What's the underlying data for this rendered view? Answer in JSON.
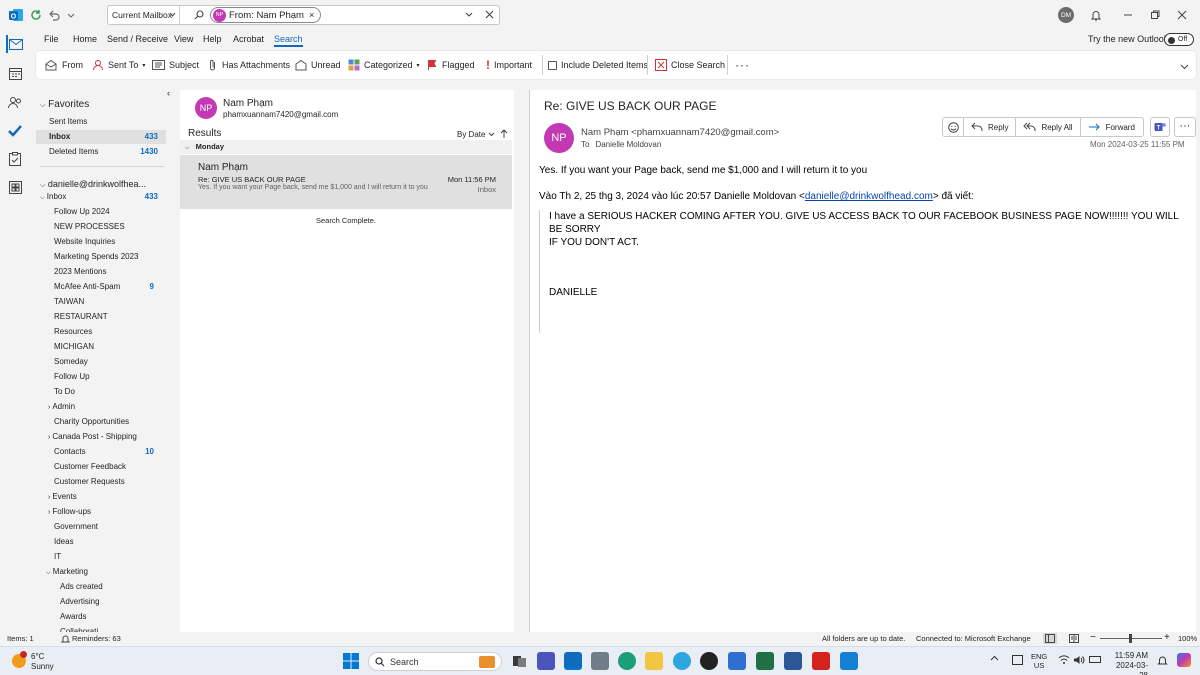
{
  "title_bar": {
    "scope": "Current Mailbox",
    "chip_initials": "NP",
    "chip_label": "From: Nam Phạm",
    "user_initials": "DM"
  },
  "menu": {
    "items": [
      "File",
      "Home",
      "Send / Receive",
      "View",
      "Help",
      "Acrobat",
      "Search"
    ],
    "active": "Search",
    "try_new": "Try the new Outlook",
    "toggle": "Off"
  },
  "ribbon": {
    "from": "From",
    "sent_to": "Sent To",
    "subject": "Subject",
    "has_attachments": "Has Attachments",
    "unread": "Unread",
    "categorized": "Categorized",
    "flagged": "Flagged",
    "important": "Important",
    "include_deleted": "Include Deleted Items",
    "close_search": "Close Search"
  },
  "folders": {
    "favorites_label": "Favorites",
    "favorites": [
      {
        "name": "Sent Items",
        "count": ""
      },
      {
        "name": "Inbox",
        "count": "433"
      },
      {
        "name": "Deleted Items",
        "count": "1430"
      }
    ],
    "account": "danielle@drinkwolfhea...",
    "inbox": {
      "name": "Inbox",
      "count": "433"
    },
    "subfolders": [
      {
        "name": "Follow Up 2024",
        "count": "",
        "exp": false
      },
      {
        "name": "NEW PROCESSES",
        "count": "",
        "exp": false
      },
      {
        "name": "Website Inquiries",
        "count": "",
        "exp": false
      },
      {
        "name": "Marketing Spends 2023",
        "count": "",
        "exp": false
      },
      {
        "name": "2023 Mentions",
        "count": "",
        "exp": false
      },
      {
        "name": "McAfee Anti-Spam",
        "count": "9",
        "exp": false
      },
      {
        "name": "TAIWAN",
        "count": "",
        "exp": false
      },
      {
        "name": "RESTAURANT",
        "count": "",
        "exp": false
      },
      {
        "name": "Resources",
        "count": "",
        "exp": false
      },
      {
        "name": "MICHIGAN",
        "count": "",
        "exp": false
      },
      {
        "name": "Someday",
        "count": "",
        "exp": false
      },
      {
        "name": "Follow Up",
        "count": "",
        "exp": false
      },
      {
        "name": "To Do",
        "count": "",
        "exp": false
      },
      {
        "name": "Admin",
        "count": "",
        "exp": true
      },
      {
        "name": "Charity Opportunities",
        "count": "",
        "exp": false
      },
      {
        "name": "Canada Post - Shipping",
        "count": "",
        "exp": true
      },
      {
        "name": "Contacts",
        "count": "10",
        "exp": false
      },
      {
        "name": "Customer Feedback",
        "count": "",
        "exp": false
      },
      {
        "name": "Customer Requests",
        "count": "",
        "exp": false
      },
      {
        "name": "Events",
        "count": "",
        "exp": true
      },
      {
        "name": "Follow-ups",
        "count": "",
        "exp": true
      },
      {
        "name": "Government",
        "count": "",
        "exp": false
      },
      {
        "name": "Ideas",
        "count": "",
        "exp": false
      },
      {
        "name": "IT",
        "count": "",
        "exp": false
      }
    ],
    "marketing": "Marketing",
    "marketing_children": [
      "Ads created",
      "Advertising",
      "Awards",
      "Collaborati..."
    ]
  },
  "list": {
    "contact_initials": "NP",
    "contact_name": "Nam Phạm",
    "contact_email": "phamxuannam7420@gmail.com",
    "results_label": "Results",
    "sort_label": "By Date",
    "group_label": "Monday",
    "item": {
      "sender": "Nam Phạm",
      "subject": "Re: GIVE US BACK OUR PAGE",
      "time": "Mon 11:56 PM",
      "preview": "Yes. If you want your Page back, send me $1,000 and I will return it to you",
      "folder": "Inbox"
    },
    "search_status": "Search Complete."
  },
  "message": {
    "subject": "Re: GIVE US BACK OUR PAGE",
    "initials": "NP",
    "from": "Nam Phạm <phamxuannam7420@gmail.com>",
    "to_label": "To",
    "to": "Danielle Moldovan",
    "date": "Mon 2024-03-25 11:55 PM",
    "reply": "Reply",
    "reply_all": "Reply All",
    "forward": "Forward",
    "body_line": "Yes. If you want your Page back, send me $1,000 and I will return it to you",
    "quote_prefix": "Vào Th 2, 25 thg 3, 2024 vào lúc 20:57 Danielle Moldovan <",
    "quote_link": "danielle@drinkwolfhead.com",
    "quote_suffix": "> đã viết:",
    "quoted_1": "I have a SERIOUS HACKER COMING AFTER YOU.  GIVE US ACCESS BACK TO OUR FACEBOOK BUSINESS PAGE NOW!!!!!!!  YOU WILL BE SORRY",
    "quoted_2": "IF YOU DON'T ACT.",
    "signature": "DANIELLE"
  },
  "status": {
    "items": "Items: 1",
    "reminders": "Reminders: 63",
    "sync": "All folders are up to date.",
    "connection": "Connected to: Microsoft Exchange",
    "zoom": "100%"
  },
  "taskbar": {
    "temp": "6°C",
    "weather": "Sunny",
    "search": "Search",
    "lang_1": "ENG",
    "lang_2": "US",
    "time": "11:59 AM",
    "date": "2024-03-28"
  },
  "colors": {
    "accent": "#0f6cbd",
    "avatar": "#c239b3",
    "selected": "#e0e0e0"
  }
}
